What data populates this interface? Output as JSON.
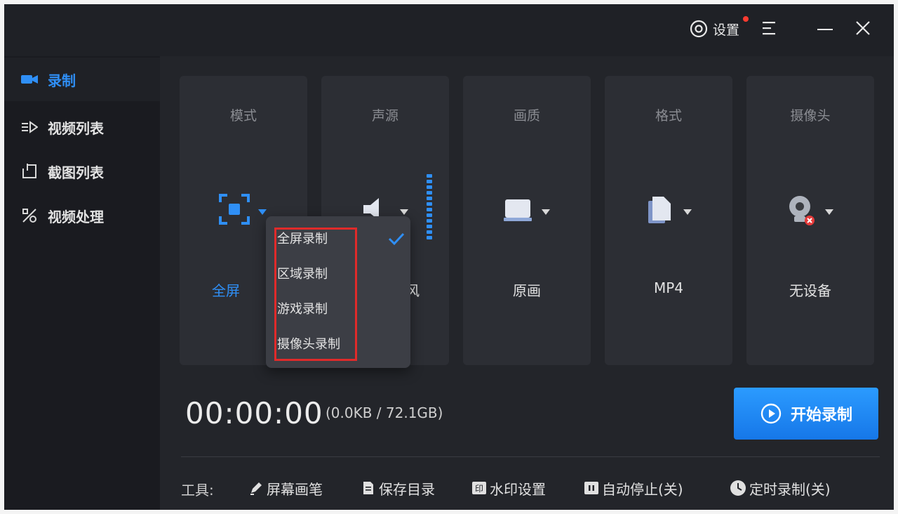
{
  "titlebar": {
    "settings_label": "设置",
    "icons": [
      "settings-icon",
      "menu-icon",
      "minimize-icon",
      "close-icon"
    ]
  },
  "sidebar": {
    "items": [
      {
        "label": "录制",
        "icon": "camera-icon",
        "active": true
      },
      {
        "label": "视频列表",
        "icon": "video-list-icon"
      },
      {
        "label": "截图列表",
        "icon": "screenshot-list-icon"
      },
      {
        "label": "视频处理",
        "icon": "video-tools-icon"
      }
    ]
  },
  "cards": [
    {
      "title": "模式",
      "value": "全屏",
      "icon": "fullscreen-icon"
    },
    {
      "title": "声源",
      "value": "风",
      "icon": "speaker-icon"
    },
    {
      "title": "画质",
      "value": "原画",
      "icon": "monitor-icon"
    },
    {
      "title": "格式",
      "value": "MP4",
      "icon": "file-icon"
    },
    {
      "title": "摄像头",
      "value": "无设备",
      "icon": "webcam-icon"
    }
  ],
  "mode_dropdown": {
    "options": [
      "全屏录制",
      "区域录制",
      "游戏录制",
      "摄像头录制"
    ],
    "selected_index": 0
  },
  "recorder": {
    "timer": "00:00:00",
    "size_info": "(0.0KB / 72.1GB)",
    "start_label": "开始录制"
  },
  "tools": {
    "label": "工具:",
    "items": [
      {
        "label": "屏幕画笔",
        "icon": "pen-icon"
      },
      {
        "label": "保存目录",
        "icon": "folder-doc-icon"
      },
      {
        "label": "水印设置",
        "icon": "watermark-icon"
      },
      {
        "label": "自动停止(关)",
        "icon": "pause-icon"
      },
      {
        "label": "定时录制(关)",
        "icon": "clock-icon"
      }
    ]
  },
  "colors": {
    "accent": "#2f8ff6",
    "background": "#1d1f24",
    "card": "#2c2e34",
    "highlight": "#e02a2a"
  }
}
